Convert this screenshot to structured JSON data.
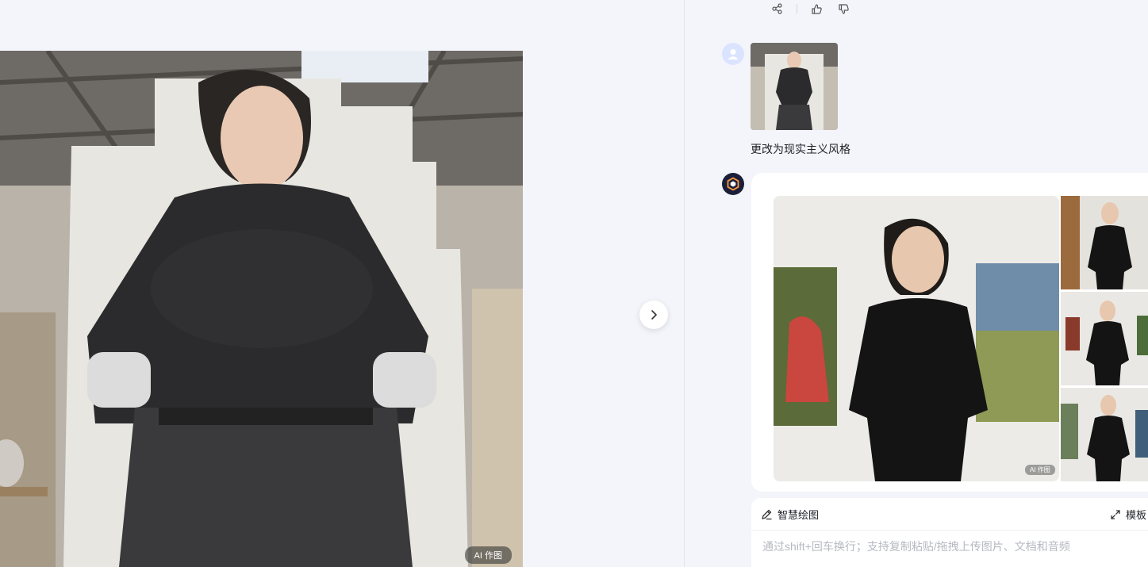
{
  "preview": {
    "ai_badge": "AI 作图",
    "next_icon": "chevron-right-icon"
  },
  "chat": {
    "previous_actions": [
      "share-icon",
      "thumbs-up-icon",
      "thumbs-down-icon"
    ],
    "user_message": {
      "avatar_icon": "user-icon",
      "text": "更改为现实主义风格"
    },
    "bot_message": {
      "avatar_icon": "bot-logo-icon",
      "ai_badge": "AI 作图"
    },
    "composer": {
      "tool_label": "智慧绘图",
      "template_label": "模板",
      "placeholder": "通过shift+回车换行；支持复制粘贴/拖拽上传图片、文档和音频"
    }
  },
  "colors": {
    "background": "#f4f5fa",
    "card": "#ffffff",
    "bot_avatar": "#1b1f3b"
  }
}
